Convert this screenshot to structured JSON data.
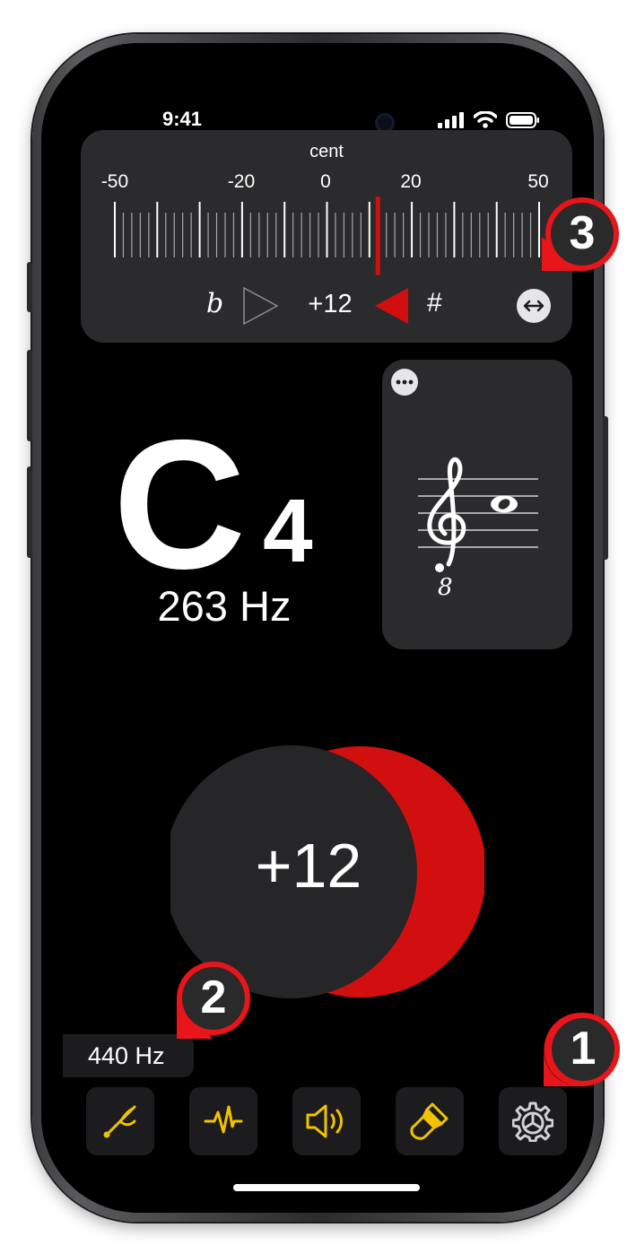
{
  "status_bar": {
    "time": "9:41"
  },
  "cent_meter": {
    "title": "cent",
    "scale_labels": [
      "-50",
      "-20",
      "0",
      "20",
      "50"
    ],
    "flat_symbol": "b",
    "sharp_symbol": "#",
    "value": "+12",
    "swap_icon": "left-right-arrow-icon"
  },
  "note": {
    "letter": "C",
    "octave": "4",
    "frequency": "263 Hz"
  },
  "staff": {
    "clef": "treble-clef-8vb",
    "more_icon": "ellipsis-icon"
  },
  "indicator": {
    "value": "+12",
    "accent_color": "#d20f0f"
  },
  "reference": {
    "label": "440 Hz"
  },
  "toolbar": {
    "items": [
      {
        "icon": "tuning-fork-icon"
      },
      {
        "icon": "waveform-icon"
      },
      {
        "icon": "speaker-icon"
      },
      {
        "icon": "paintbrush-icon"
      },
      {
        "icon": "gear-icon"
      }
    ],
    "accent_color": "#f2c200"
  },
  "callouts": [
    "1",
    "2",
    "3"
  ]
}
